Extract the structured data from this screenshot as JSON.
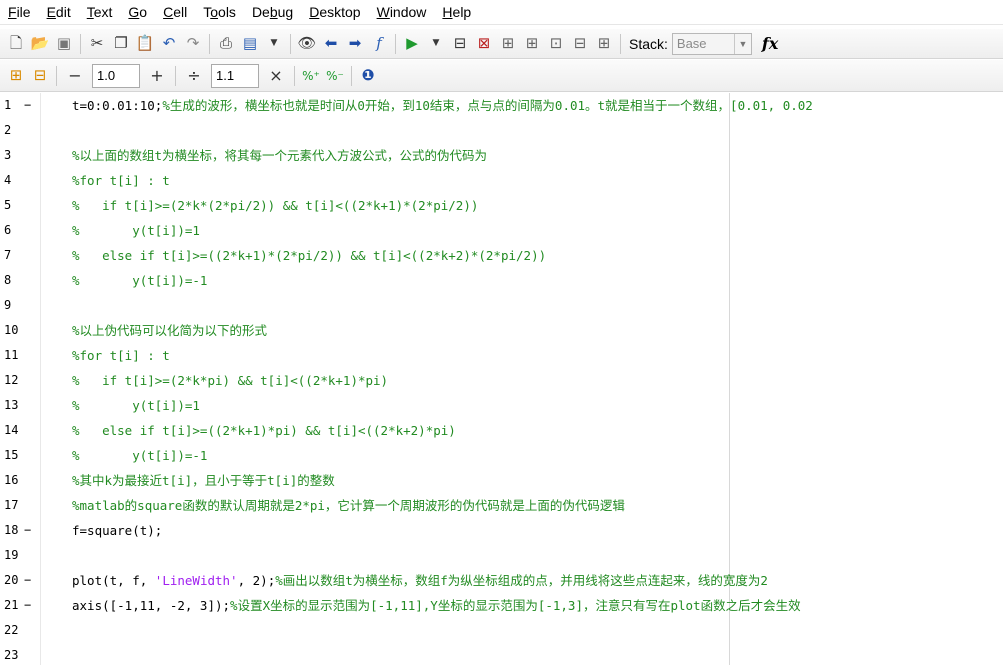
{
  "menu": [
    "File",
    "Edit",
    "Text",
    "Go",
    "Cell",
    "Tools",
    "Debug",
    "Desktop",
    "Window",
    "Help"
  ],
  "menu_underline": [
    "F",
    "E",
    "T",
    "G",
    "C",
    "o",
    "b",
    "D",
    "W",
    "H"
  ],
  "toolbar": {
    "stack_label": "Stack:",
    "stack_value": "Base",
    "fx_label": "fx"
  },
  "cell_toolbar": {
    "minus_label": "−",
    "first_value": "1.0",
    "plus_label": "+",
    "divide_label": "÷",
    "second_value": "1.1",
    "times_label": "×"
  },
  "colors": {
    "comment": "#228B22",
    "string": "#A020F0",
    "code": "#000000"
  },
  "editor": {
    "lines": [
      {
        "n": "1",
        "exec": "−",
        "parts": [
          {
            "t": "t=0:0.01:10;",
            "c": "code"
          },
          {
            "t": "%生成的波形，横坐标也就是时间从0开始，到10结束，点与点的间隔为0.01。t就是相当于一个数组，[0.01, 0.02",
            "c": "cm"
          }
        ]
      },
      {
        "n": "2",
        "exec": "",
        "parts": []
      },
      {
        "n": "3",
        "exec": "",
        "parts": [
          {
            "t": "%以上面的数组t为横坐标，将其每一个元素代入方波公式，公式的伪代码为",
            "c": "cm"
          }
        ]
      },
      {
        "n": "4",
        "exec": "",
        "parts": [
          {
            "t": "%for t[i] : t",
            "c": "cm"
          }
        ]
      },
      {
        "n": "5",
        "exec": "",
        "parts": [
          {
            "t": "%   if t[i]>=(2*k*(2*pi/2)) && t[i]<((2*k+1)*(2*pi/2))",
            "c": "cm"
          }
        ]
      },
      {
        "n": "6",
        "exec": "",
        "parts": [
          {
            "t": "%       y(t[i])=1",
            "c": "cm"
          }
        ]
      },
      {
        "n": "7",
        "exec": "",
        "parts": [
          {
            "t": "%   else if t[i]>=((2*k+1)*(2*pi/2)) && t[i]<((2*k+2)*(2*pi/2))",
            "c": "cm"
          }
        ]
      },
      {
        "n": "8",
        "exec": "",
        "parts": [
          {
            "t": "%       y(t[i])=-1",
            "c": "cm"
          }
        ]
      },
      {
        "n": "9",
        "exec": "",
        "parts": []
      },
      {
        "n": "10",
        "exec": "",
        "parts": [
          {
            "t": "%以上伪代码可以化简为以下的形式",
            "c": "cm"
          }
        ]
      },
      {
        "n": "11",
        "exec": "",
        "parts": [
          {
            "t": "%for t[i] : t",
            "c": "cm"
          }
        ]
      },
      {
        "n": "12",
        "exec": "",
        "parts": [
          {
            "t": "%   if t[i]>=(2*k*pi) && t[i]<((2*k+1)*pi)",
            "c": "cm"
          }
        ]
      },
      {
        "n": "13",
        "exec": "",
        "parts": [
          {
            "t": "%       y(t[i])=1",
            "c": "cm"
          }
        ]
      },
      {
        "n": "14",
        "exec": "",
        "parts": [
          {
            "t": "%   else if t[i]>=((2*k+1)*pi) && t[i]<((2*k+2)*pi)",
            "c": "cm"
          }
        ]
      },
      {
        "n": "15",
        "exec": "",
        "parts": [
          {
            "t": "%       y(t[i])=-1",
            "c": "cm"
          }
        ]
      },
      {
        "n": "16",
        "exec": "",
        "parts": [
          {
            "t": "%其中k为最接近t[i]，且小于等于t[i]的整数",
            "c": "cm"
          }
        ]
      },
      {
        "n": "17",
        "exec": "",
        "parts": [
          {
            "t": "%matlab的square函数的默认周期就是2*pi，它计算一个周期波形的伪代码就是上面的伪代码逻辑",
            "c": "cm"
          }
        ]
      },
      {
        "n": "18",
        "exec": "−",
        "parts": [
          {
            "t": "f=square(t);",
            "c": "code"
          }
        ]
      },
      {
        "n": "19",
        "exec": "",
        "parts": []
      },
      {
        "n": "20",
        "exec": "−",
        "parts": [
          {
            "t": "plot(t, f, ",
            "c": "code"
          },
          {
            "t": "'LineWidth'",
            "c": "str"
          },
          {
            "t": ", 2);",
            "c": "code"
          },
          {
            "t": "%画出以数组t为横坐标，数组f为纵坐标组成的点，并用线将这些点连起来，线的宽度为2",
            "c": "cm"
          }
        ]
      },
      {
        "n": "21",
        "exec": "−",
        "parts": [
          {
            "t": "axis([-1,11, -2, 3]);",
            "c": "code"
          },
          {
            "t": "%设置X坐标的显示范围为[-1,11],Y坐标的显示范围为[-1,3]，注意只有写在plot函数之后才会生效",
            "c": "cm"
          }
        ]
      },
      {
        "n": "22",
        "exec": "",
        "parts": []
      },
      {
        "n": "23",
        "exec": "",
        "parts": []
      }
    ]
  }
}
